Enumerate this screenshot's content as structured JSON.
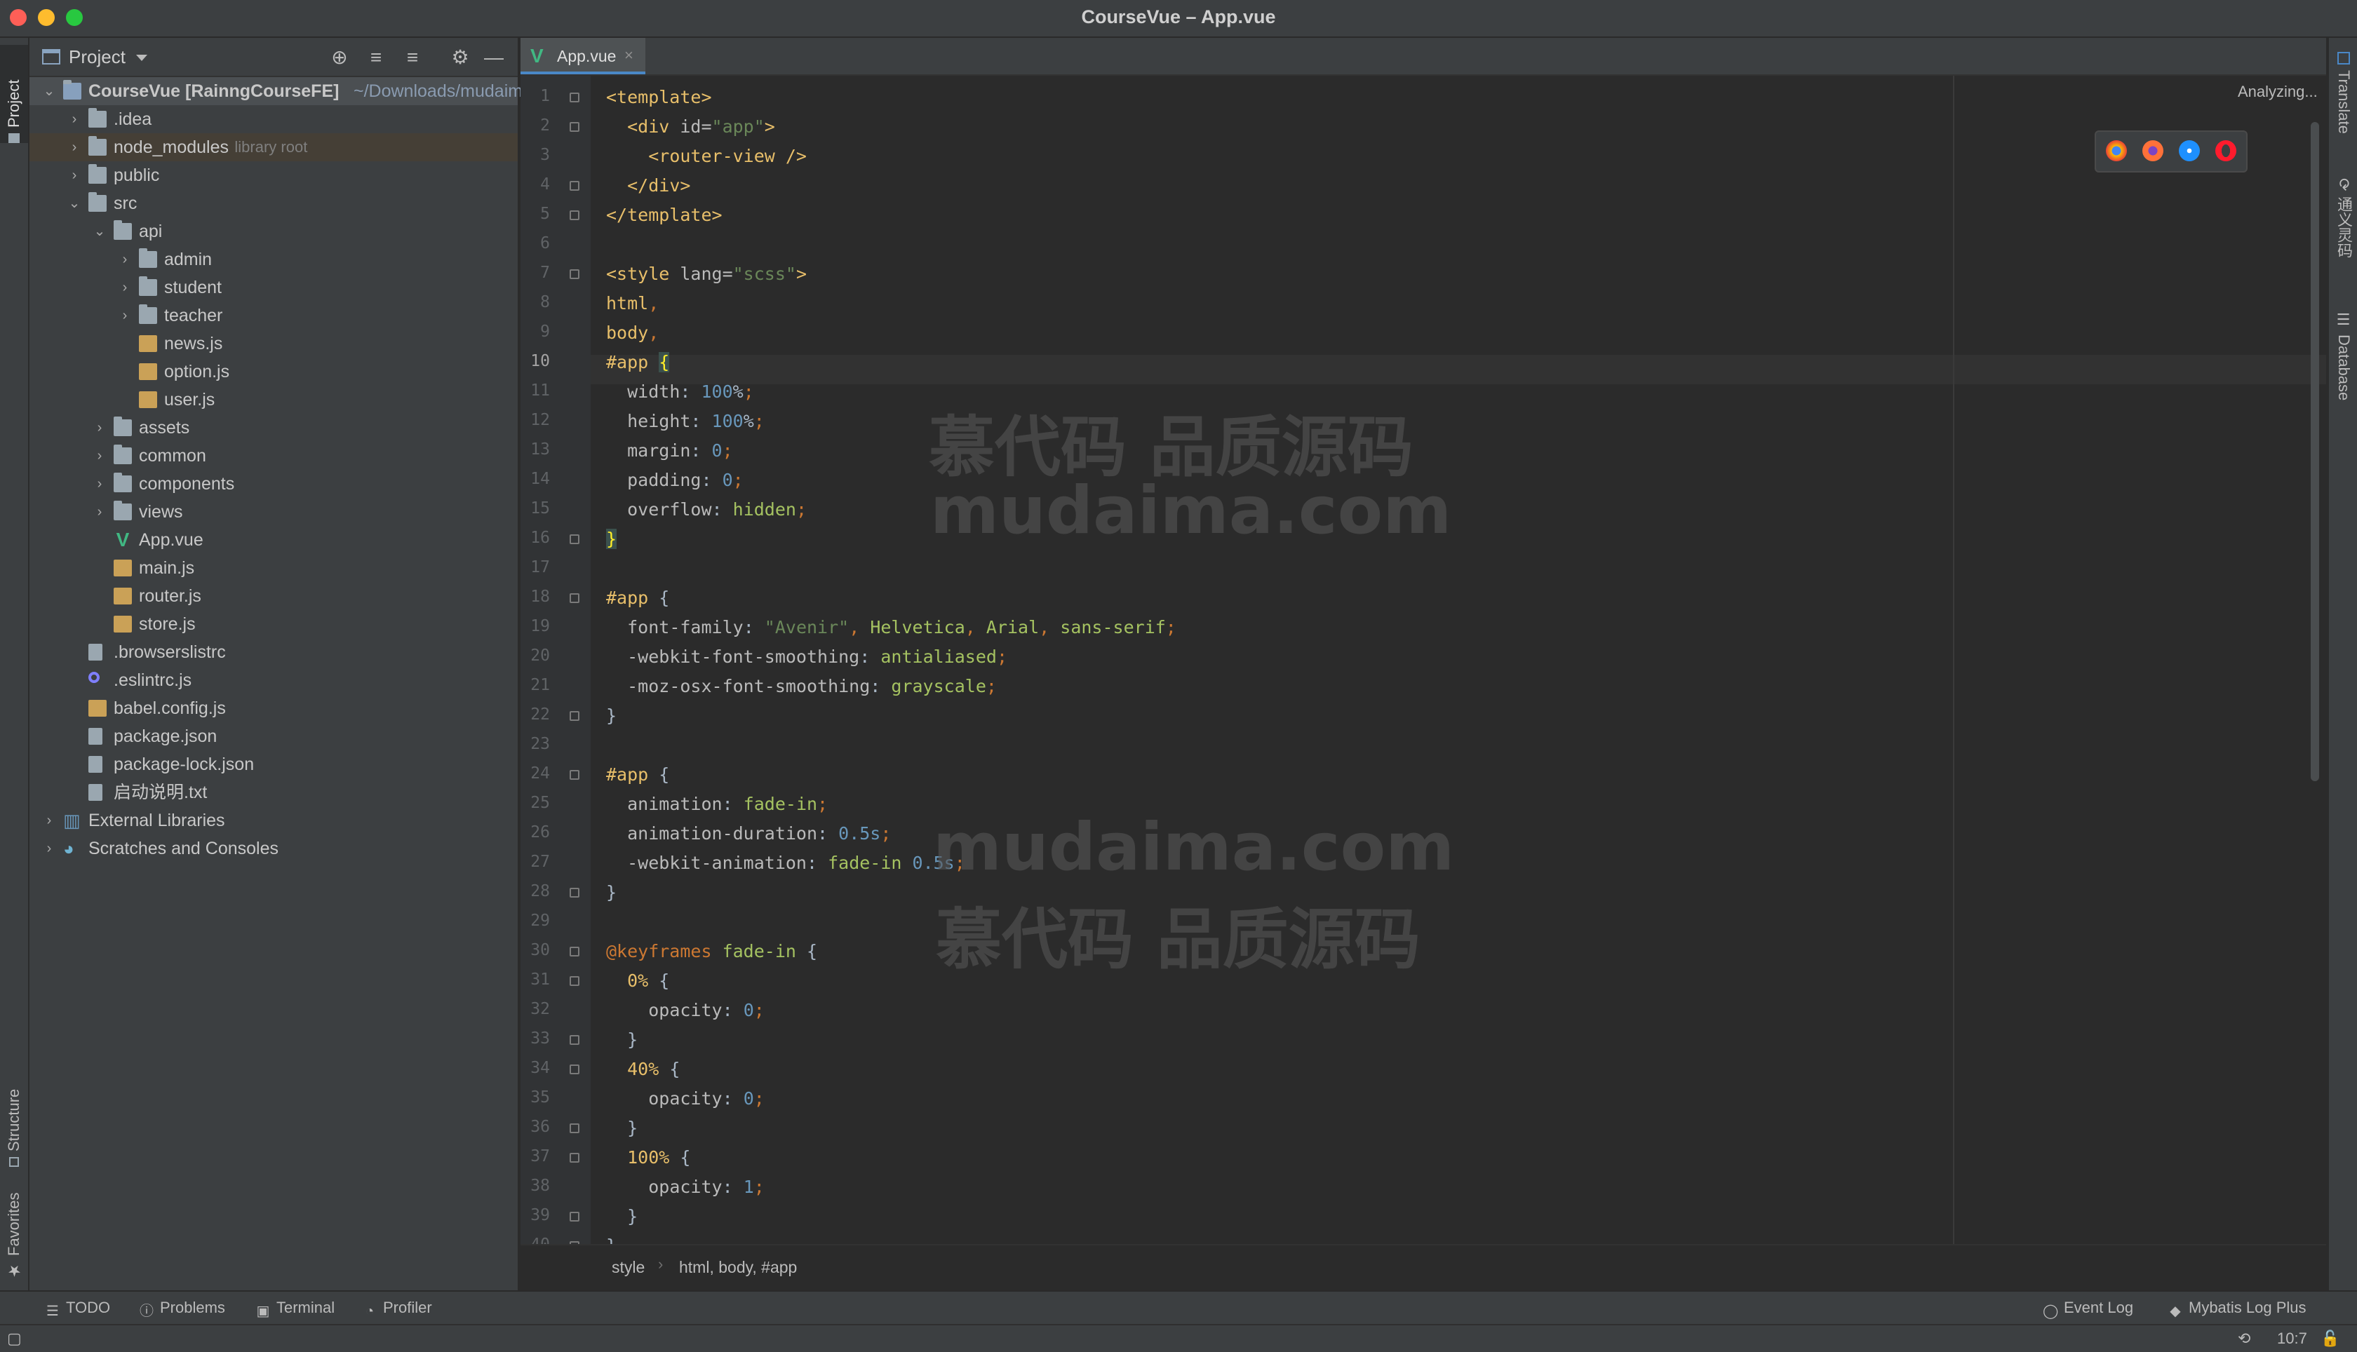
{
  "window": {
    "title": "CourseVue – App.vue"
  },
  "left_strip": {
    "project": "Project",
    "structure": "Structure",
    "favorites": "Favorites"
  },
  "right_strip": {
    "translate": "Translate",
    "tongyi": "通义灵码",
    "database": "Database"
  },
  "project_panel": {
    "title": "Project",
    "tree": [
      {
        "depth": 0,
        "arrow": "open",
        "icon": "module",
        "label": "CourseVue [RainngCourseFE]",
        "suffix": "~/Downloads/mudaima",
        "bold": true,
        "selected": true
      },
      {
        "depth": 1,
        "arrow": "closed",
        "icon": "folder",
        "label": ".idea"
      },
      {
        "depth": 1,
        "arrow": "closed",
        "icon": "folder",
        "label": "node_modules",
        "suffix": "library root",
        "lib": true
      },
      {
        "depth": 1,
        "arrow": "closed",
        "icon": "folder",
        "label": "public"
      },
      {
        "depth": 1,
        "arrow": "open",
        "icon": "folder",
        "label": "src"
      },
      {
        "depth": 2,
        "arrow": "open",
        "icon": "folder",
        "label": "api"
      },
      {
        "depth": 3,
        "arrow": "closed",
        "icon": "folder",
        "label": "admin"
      },
      {
        "depth": 3,
        "arrow": "closed",
        "icon": "folder",
        "label": "student"
      },
      {
        "depth": 3,
        "arrow": "closed",
        "icon": "folder",
        "label": "teacher"
      },
      {
        "depth": 3,
        "arrow": "none",
        "icon": "js",
        "label": "news.js"
      },
      {
        "depth": 3,
        "arrow": "none",
        "icon": "js",
        "label": "option.js"
      },
      {
        "depth": 3,
        "arrow": "none",
        "icon": "js",
        "label": "user.js"
      },
      {
        "depth": 2,
        "arrow": "closed",
        "icon": "folder",
        "label": "assets"
      },
      {
        "depth": 2,
        "arrow": "closed",
        "icon": "folder",
        "label": "common"
      },
      {
        "depth": 2,
        "arrow": "closed",
        "icon": "folder",
        "label": "components"
      },
      {
        "depth": 2,
        "arrow": "closed",
        "icon": "folder",
        "label": "views"
      },
      {
        "depth": 2,
        "arrow": "none",
        "icon": "vue",
        "label": "App.vue"
      },
      {
        "depth": 2,
        "arrow": "none",
        "icon": "js",
        "label": "main.js"
      },
      {
        "depth": 2,
        "arrow": "none",
        "icon": "js",
        "label": "router.js"
      },
      {
        "depth": 2,
        "arrow": "none",
        "icon": "js",
        "label": "store.js"
      },
      {
        "depth": 1,
        "arrow": "none",
        "icon": "txt",
        "label": ".browserslistrc"
      },
      {
        "depth": 1,
        "arrow": "none",
        "icon": "eslint",
        "label": ".eslintrc.js"
      },
      {
        "depth": 1,
        "arrow": "none",
        "icon": "js",
        "label": "babel.config.js"
      },
      {
        "depth": 1,
        "arrow": "none",
        "icon": "json",
        "label": "package.json"
      },
      {
        "depth": 1,
        "arrow": "none",
        "icon": "json",
        "label": "package-lock.json"
      },
      {
        "depth": 1,
        "arrow": "none",
        "icon": "txt",
        "label": "启动说明.txt"
      },
      {
        "depth": 0,
        "arrow": "closed",
        "icon": "libs",
        "label": "External Libraries"
      },
      {
        "depth": 0,
        "arrow": "closed",
        "icon": "scratch",
        "label": "Scratches and Consoles"
      }
    ]
  },
  "editor": {
    "tab": {
      "label": "App.vue"
    },
    "status_text": "Analyzing...",
    "current_line": 10,
    "lines": [
      [
        [
          "tag",
          "<template>"
        ]
      ],
      [
        [
          "plain",
          "  "
        ],
        [
          "tag",
          "<div "
        ],
        [
          "attr",
          "id="
        ],
        [
          "str",
          "\"app\""
        ],
        [
          "tag",
          ">"
        ]
      ],
      [
        [
          "plain",
          "    "
        ],
        [
          "tag",
          "<router-view />"
        ]
      ],
      [
        [
          "plain",
          "  "
        ],
        [
          "tag",
          "</div>"
        ]
      ],
      [
        [
          "tag",
          "</template>"
        ]
      ],
      [],
      [
        [
          "tag",
          "<style "
        ],
        [
          "attr",
          "lang="
        ],
        [
          "str",
          "\"scss\""
        ],
        [
          "tag",
          ">"
        ]
      ],
      [
        [
          "sel",
          "html"
        ],
        [
          "kw",
          ","
        ]
      ],
      [
        [
          "sel",
          "body"
        ],
        [
          "kw",
          ","
        ]
      ],
      [
        [
          "sel",
          "#app "
        ],
        [
          "hl",
          "{"
        ]
      ],
      [
        [
          "plain",
          "  "
        ],
        [
          "prop",
          "width"
        ],
        [
          "plain",
          ": "
        ],
        [
          "num",
          "100"
        ],
        [
          "plain",
          "%"
        ],
        [
          "kw",
          ";"
        ]
      ],
      [
        [
          "plain",
          "  "
        ],
        [
          "prop",
          "height"
        ],
        [
          "plain",
          ": "
        ],
        [
          "num",
          "100"
        ],
        [
          "plain",
          "%"
        ],
        [
          "kw",
          ";"
        ]
      ],
      [
        [
          "plain",
          "  "
        ],
        [
          "prop",
          "margin"
        ],
        [
          "plain",
          ": "
        ],
        [
          "num",
          "0"
        ],
        [
          "kw",
          ";"
        ]
      ],
      [
        [
          "plain",
          "  "
        ],
        [
          "prop",
          "padding"
        ],
        [
          "plain",
          ": "
        ],
        [
          "num",
          "0"
        ],
        [
          "kw",
          ";"
        ]
      ],
      [
        [
          "plain",
          "  "
        ],
        [
          "prop",
          "overflow"
        ],
        [
          "plain",
          ": "
        ],
        [
          "val",
          "hidden"
        ],
        [
          "kw",
          ";"
        ]
      ],
      [
        [
          "hl",
          "}"
        ]
      ],
      [],
      [
        [
          "sel",
          "#app "
        ],
        [
          "plain",
          "{"
        ]
      ],
      [
        [
          "plain",
          "  "
        ],
        [
          "prop",
          "font-family"
        ],
        [
          "plain",
          ": "
        ],
        [
          "str",
          "\"Avenir\""
        ],
        [
          "kw",
          ", "
        ],
        [
          "val",
          "Helvetica"
        ],
        [
          "kw",
          ", "
        ],
        [
          "val",
          "Arial"
        ],
        [
          "kw",
          ", "
        ],
        [
          "val",
          "sans-serif"
        ],
        [
          "kw",
          ";"
        ]
      ],
      [
        [
          "plain",
          "  "
        ],
        [
          "prop",
          "-webkit-font-smoothing"
        ],
        [
          "plain",
          ": "
        ],
        [
          "val",
          "antialiased"
        ],
        [
          "kw",
          ";"
        ]
      ],
      [
        [
          "plain",
          "  "
        ],
        [
          "prop",
          "-moz-osx-font-smoothing"
        ],
        [
          "plain",
          ": "
        ],
        [
          "val",
          "grayscale"
        ],
        [
          "kw",
          ";"
        ]
      ],
      [
        [
          "plain",
          "}"
        ]
      ],
      [],
      [
        [
          "sel",
          "#app "
        ],
        [
          "plain",
          "{"
        ]
      ],
      [
        [
          "plain",
          "  "
        ],
        [
          "prop",
          "animation"
        ],
        [
          "plain",
          ": "
        ],
        [
          "val",
          "fade-in"
        ],
        [
          "kw",
          ";"
        ]
      ],
      [
        [
          "plain",
          "  "
        ],
        [
          "prop",
          "animation-duration"
        ],
        [
          "plain",
          ": "
        ],
        [
          "num",
          "0.5s"
        ],
        [
          "kw",
          ";"
        ]
      ],
      [
        [
          "plain",
          "  "
        ],
        [
          "prop",
          "-webkit-animation"
        ],
        [
          "plain",
          ": "
        ],
        [
          "val",
          "fade-in "
        ],
        [
          "num",
          "0.5s"
        ],
        [
          "kw",
          ";"
        ]
      ],
      [
        [
          "plain",
          "}"
        ]
      ],
      [],
      [
        [
          "kw",
          "@keyframes "
        ],
        [
          "val",
          "fade-in "
        ],
        [
          "plain",
          "{"
        ]
      ],
      [
        [
          "plain",
          "  "
        ],
        [
          "sel",
          "0% "
        ],
        [
          "plain",
          "{"
        ]
      ],
      [
        [
          "plain",
          "    "
        ],
        [
          "prop",
          "opacity"
        ],
        [
          "plain",
          ": "
        ],
        [
          "num",
          "0"
        ],
        [
          "kw",
          ";"
        ]
      ],
      [
        [
          "plain",
          "  }"
        ]
      ],
      [
        [
          "plain",
          "  "
        ],
        [
          "sel",
          "40% "
        ],
        [
          "plain",
          "{"
        ]
      ],
      [
        [
          "plain",
          "    "
        ],
        [
          "prop",
          "opacity"
        ],
        [
          "plain",
          ": "
        ],
        [
          "num",
          "0"
        ],
        [
          "kw",
          ";"
        ]
      ],
      [
        [
          "plain",
          "  }"
        ]
      ],
      [
        [
          "plain",
          "  "
        ],
        [
          "sel",
          "100% "
        ],
        [
          "plain",
          "{"
        ]
      ],
      [
        [
          "plain",
          "    "
        ],
        [
          "prop",
          "opacity"
        ],
        [
          "plain",
          ": "
        ],
        [
          "num",
          "1"
        ],
        [
          "kw",
          ";"
        ]
      ],
      [
        [
          "plain",
          "  }"
        ]
      ],
      [
        [
          "plain",
          "}"
        ]
      ]
    ],
    "folds": [
      1,
      2,
      4,
      5,
      7,
      16,
      18,
      22,
      24,
      28,
      30,
      31,
      33,
      34,
      36,
      37,
      39,
      40
    ],
    "breadcrumbs": [
      "style",
      "html, body, #app"
    ]
  },
  "watermarks": {
    "top_line1": "慕代码 品质源码",
    "top_line2": "mudaima.com",
    "bottom_line1": "mudaima.com",
    "bottom_line2": "慕代码 品质源码"
  },
  "toolwindows": {
    "todo": "TODO",
    "problems": "Problems",
    "terminal": "Terminal",
    "profiler": "Profiler",
    "event_log": "Event Log",
    "mybatis": "Mybatis Log Plus"
  },
  "status": {
    "position": "10:7"
  },
  "colors": {
    "background": "#2b2b2b",
    "panel": "#3c3f41",
    "accent": "#4a88c7",
    "vue": "#41b883"
  }
}
